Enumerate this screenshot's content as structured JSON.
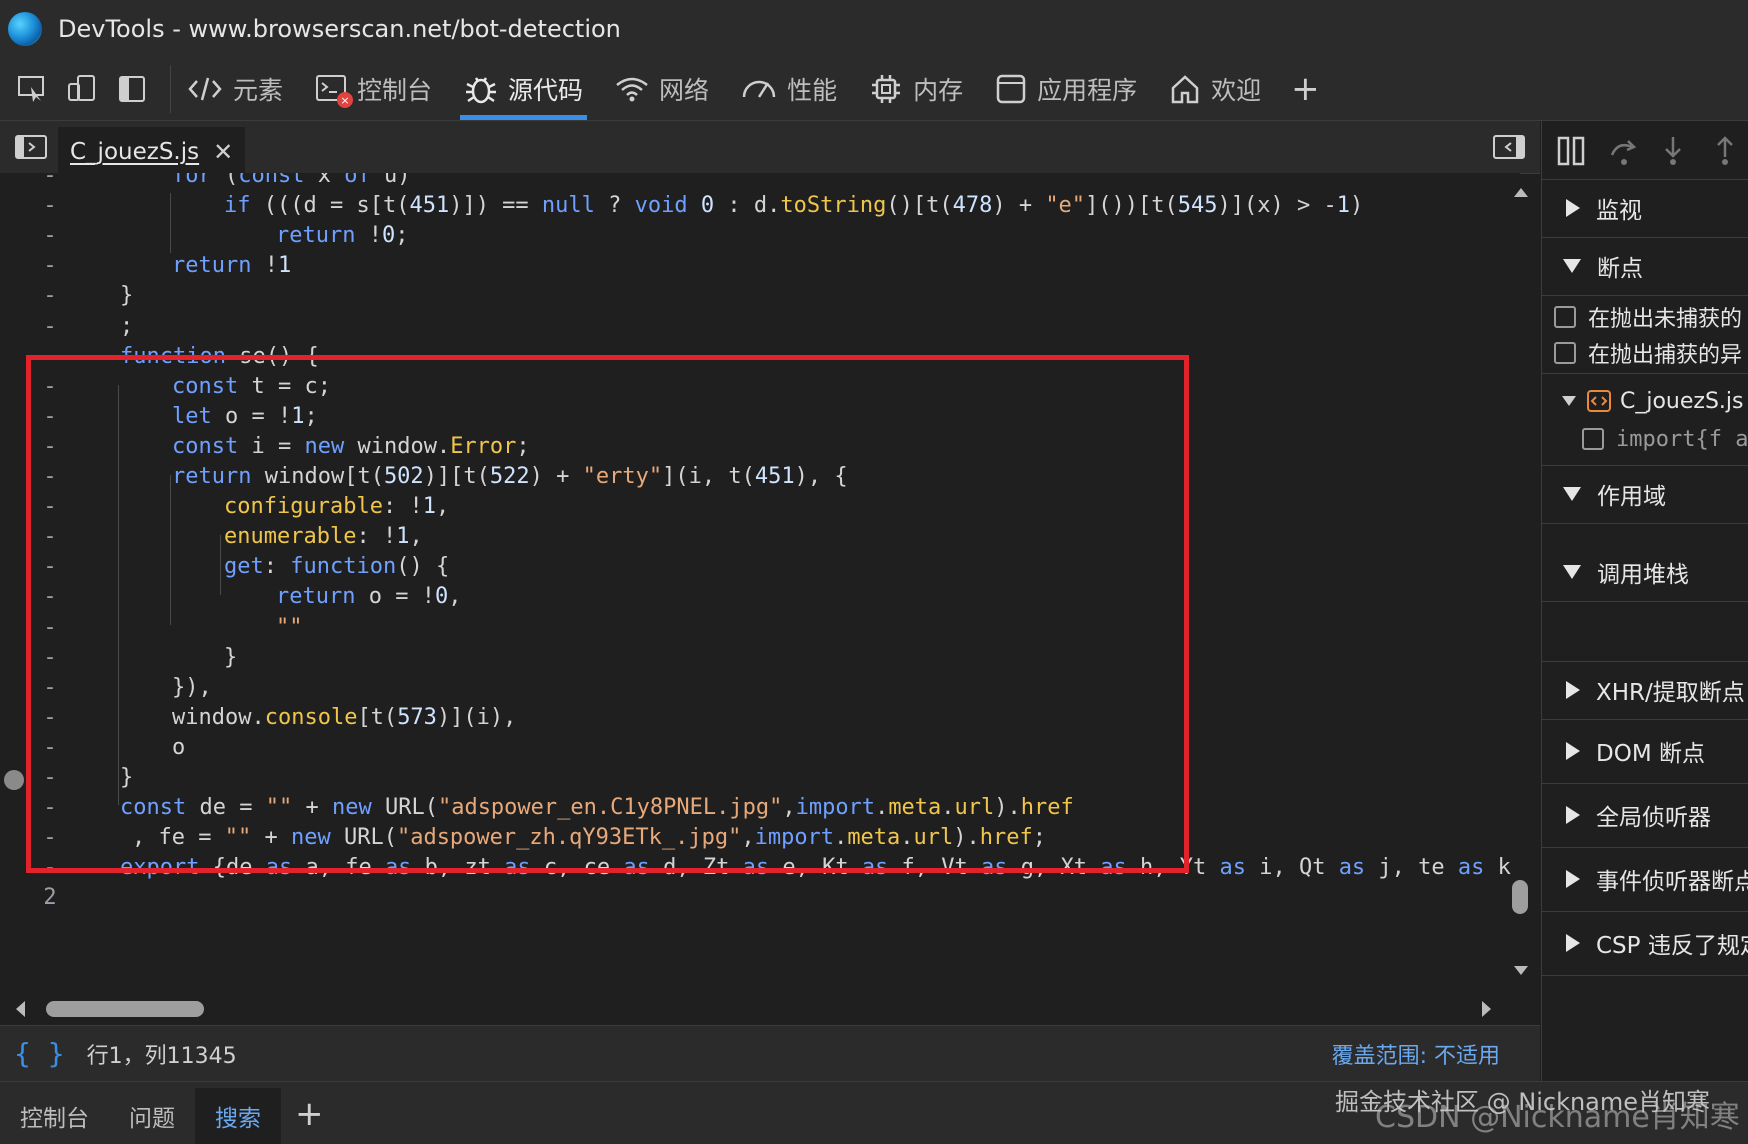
{
  "window": {
    "title": "DevTools - www.browserscan.net/bot-detection"
  },
  "toolbar": {
    "tabs": [
      {
        "label": "元素",
        "icon": "code-icon"
      },
      {
        "label": "控制台",
        "icon": "console-icon"
      },
      {
        "label": "源代码",
        "icon": "bug-icon",
        "active": true
      },
      {
        "label": "网络",
        "icon": "wifi-icon"
      },
      {
        "label": "性能",
        "icon": "gauge-icon"
      },
      {
        "label": "内存",
        "icon": "chip-icon"
      },
      {
        "label": "应用程序",
        "icon": "app-window-icon"
      },
      {
        "label": "欢迎",
        "icon": "home-icon"
      }
    ],
    "console_badge": "×",
    "plus": "+"
  },
  "editor": {
    "file_tab": "C_jouezS.js",
    "close": "✕"
  },
  "code": {
    "gutter_marks": [
      "-",
      "-",
      "-",
      "-",
      "-",
      "-",
      "-",
      "-",
      "-",
      "-",
      "-",
      "-",
      "-",
      "-",
      "-",
      "-",
      "-",
      "-",
      "-",
      "-",
      "-",
      "-",
      "-",
      "-",
      "2"
    ],
    "lines": [
      "for (const x of u)",
      "if (((d = s[t(451)]) == null ? void 0 : d.toString()[t(478) + \"e\"]())[t(545)](x) > -1)",
      "return !0;",
      "return !1",
      "}",
      ";",
      "function se() {",
      "const t = c;",
      "let o = !1;",
      "const i = new window.Error;",
      "return window[t(502)][t(522) + \"erty\"](i, t(451), {",
      "configurable: !1,",
      "enumerable: !1,",
      "get: function() {",
      "return o = !0,",
      "\"\"",
      "}",
      "}),",
      "window.console[t(573)](i),",
      "o",
      "}",
      "const de = \"\" + new URL(\"adspower_en.C1y8PNEL.jpg\",import.meta.url).href",
      ", fe = \"\" + new URL(\"adspower_zh.qY93ETk_.jpg\",import.meta.url).href;",
      "export {de as a, fe as b, zt as c, ce as d, Zt as e, Kt as f, Vt as g, Xt as h, Yt as i, Qt as j, te as k",
      ""
    ]
  },
  "status": {
    "braces": "{ }",
    "position": "行1，列11345",
    "coverage": "覆盖范围: 不适用"
  },
  "drawer": {
    "tabs": [
      "控制台",
      "问题",
      "搜索"
    ],
    "active": "搜索",
    "plus": "+"
  },
  "watermark": {
    "line1": "掘金技术社区 @ Nickname肖知寒",
    "line2": "CSDN @Nickname肖知寒"
  },
  "sidebar": {
    "watch": "监视",
    "breakpoints": "断点",
    "pause_uncaught": "在抛出未捕获的",
    "pause_caught": "在抛出捕获的异",
    "bp_file": "C_jouezS.js",
    "bp_code": "import{f a",
    "scope": "作用域",
    "call_stack": "调用堆栈",
    "xhr": "XHR/提取断点",
    "dom": "DOM 断点",
    "global": "全局侦听器",
    "event": "事件侦听器断点",
    "csp": "CSP 违反了规定"
  }
}
